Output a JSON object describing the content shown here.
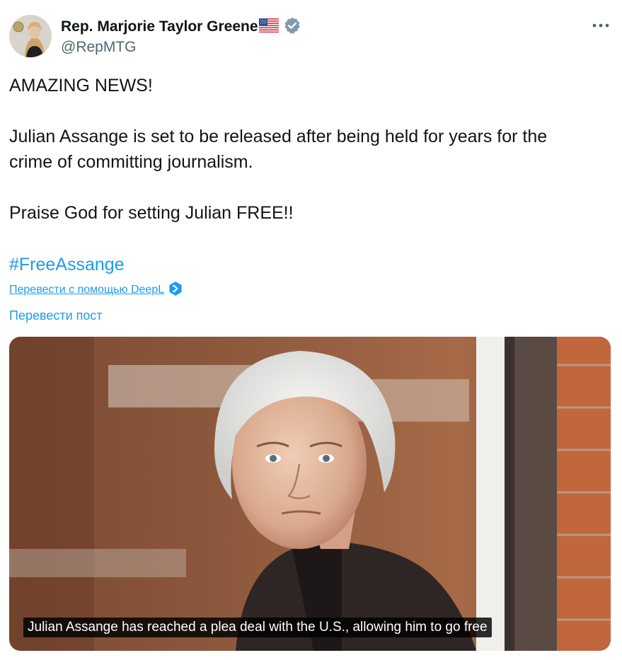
{
  "author": {
    "display_name": "Rep. Marjorie Taylor Greene",
    "handle": "@RepMTG",
    "flag_icon": "us-flag-icon",
    "verified_icon": "verified-badge-icon",
    "verified_color": "#829aab"
  },
  "menu": {
    "more_icon": "more-options-icon"
  },
  "tweet": {
    "line1": "AMAZING NEWS!",
    "line2": "Julian Assange is set to be released after being held for years for the",
    "line3": "crime of committing journalism.",
    "line4": "Praise God for setting Julian FREE!!",
    "hashtag": "#FreeAssange"
  },
  "translation": {
    "deepl_label": "Перевести с помощью DeepL",
    "deepl_icon": "deepl-icon",
    "translate_post_label": "Перевести пост"
  },
  "media": {
    "caption": "Julian Assange has reached a plea deal with the U.S., allowing him to go free"
  },
  "colors": {
    "link": "#1d9bf0",
    "text": "#0f1419",
    "secondary": "#536471"
  }
}
